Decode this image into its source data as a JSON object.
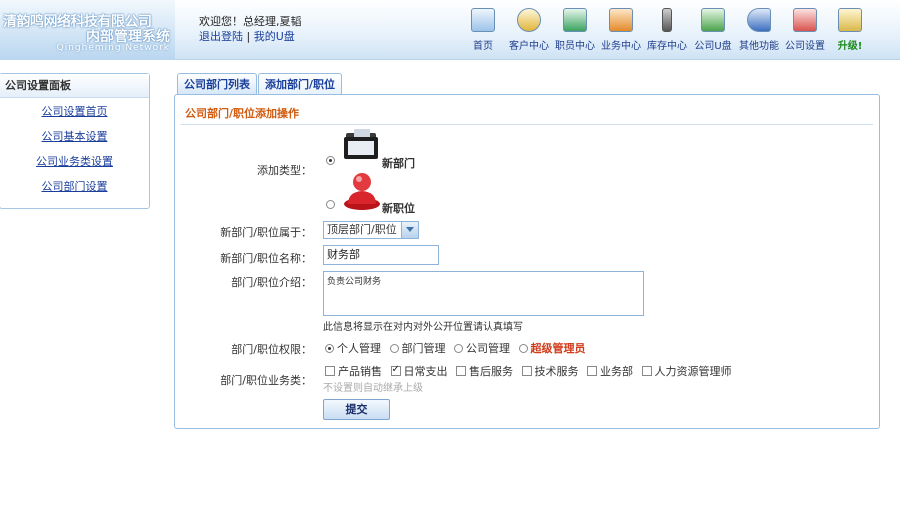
{
  "header": {
    "logo_line1": "清韵鸣网络科技有限公司",
    "logo_line2": "内部管理系统",
    "logo_line3": "Qingheming Network",
    "welcome": "欢迎您！总经理,夏韬",
    "logout": "退出登陆",
    "separator": "|",
    "my_disk": "我的U盘"
  },
  "nav": [
    {
      "label": "首页",
      "icon": "home-icon",
      "color": "#4f8fcf"
    },
    {
      "label": "客户中心",
      "icon": "customer-icon",
      "color": "#e0b53a"
    },
    {
      "label": "职员中心",
      "icon": "staff-icon",
      "color": "#3aa260"
    },
    {
      "label": "业务中心",
      "icon": "business-icon",
      "color": "#e38a2a"
    },
    {
      "label": "库存中心",
      "icon": "inventory-icon",
      "color": "#555555"
    },
    {
      "label": "公司U盘",
      "icon": "usb-disk-icon",
      "color": "#4aa34a"
    },
    {
      "label": "其他功能",
      "icon": "other-functions-icon",
      "color": "#3d6fc0"
    },
    {
      "label": "公司设置",
      "icon": "company-settings-icon",
      "color": "#d9534f"
    },
    {
      "label": "升级!",
      "icon": "upgrade-icon",
      "color": "#d9b84a"
    }
  ],
  "sidebar": {
    "title": "公司设置面板",
    "items": [
      "公司设置首页",
      "公司基本设置",
      "公司业务类设置",
      "公司部门设置"
    ]
  },
  "tabs": [
    "公司部门列表",
    "添加部门/职位"
  ],
  "form": {
    "title": "公司部门/职位添加操作",
    "type_label": "添加类型：",
    "type_options": [
      "新部门",
      "新职位"
    ],
    "parent_label": "新部门/职位属于：",
    "parent_value": "顶层部门/职位",
    "name_label": "新部门/职位名称：",
    "name_value": "财务部",
    "intro_label": "部门/职位介绍：",
    "intro_value": "负责公司财务",
    "intro_hint": "此信息将显示在对内对外公开位置请认真填写",
    "perm_label": "部门/职位权限：",
    "perm_options": [
      "个人管理",
      "部门管理",
      "公司管理",
      "超级管理员"
    ],
    "biz_label": "部门/职位业务类：",
    "biz_options": [
      "产品销售",
      "日常支出",
      "售后服务",
      "技术服务",
      "业务部",
      "人力资源管理师"
    ],
    "biz_hint": "不设置则自动继承上级",
    "submit": "提交"
  },
  "colors": {
    "accent": "#1a3e9c",
    "title_orange": "#d15b0f",
    "super_admin_red": "#d23c1a",
    "border_blue": "#98bde2"
  }
}
